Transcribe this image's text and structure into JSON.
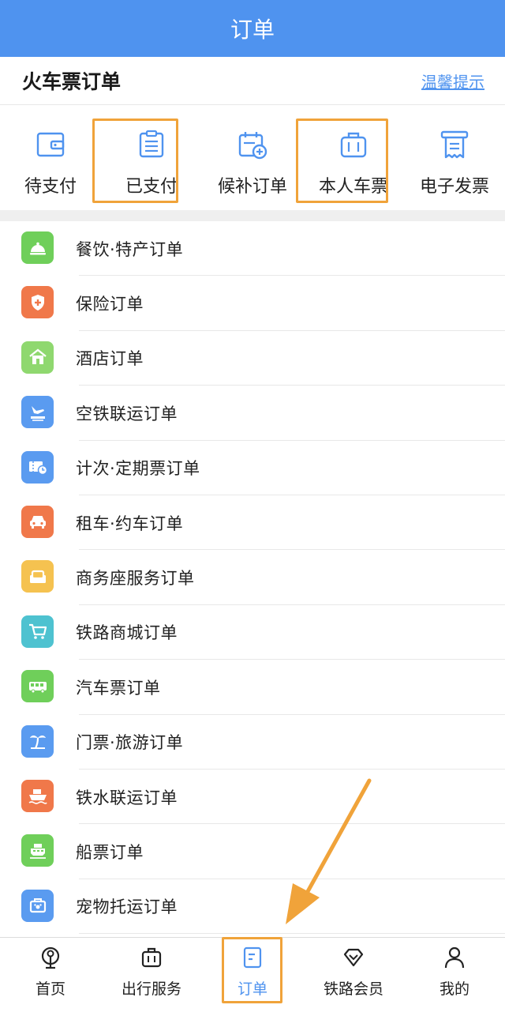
{
  "header": {
    "title": "订单"
  },
  "section": {
    "title": "火车票订单",
    "tips_link": "温馨提示"
  },
  "quick_actions": [
    {
      "label": "待支付",
      "icon": "wallet-icon"
    },
    {
      "label": "已支付",
      "icon": "paid-list-icon"
    },
    {
      "label": "候补订单",
      "icon": "calendar-add-icon"
    },
    {
      "label": "本人车票",
      "icon": "luggage-icon"
    },
    {
      "label": "电子发票",
      "icon": "invoice-icon"
    }
  ],
  "orders": [
    {
      "label": "餐饮·特产订单",
      "icon": "dining-bell-icon",
      "color": "#6fcf5a"
    },
    {
      "label": "保险订单",
      "icon": "shield-plus-icon",
      "color": "#f0784a"
    },
    {
      "label": "酒店订单",
      "icon": "hotel-icon",
      "color": "#8fd86f"
    },
    {
      "label": "空铁联运订单",
      "icon": "plane-train-icon",
      "color": "#5a9bf0"
    },
    {
      "label": "计次·定期票订单",
      "icon": "ticket-clock-icon",
      "color": "#5a9bf0"
    },
    {
      "label": "租车·约车订单",
      "icon": "car-icon",
      "color": "#f0784a"
    },
    {
      "label": "商务座服务订单",
      "icon": "sofa-icon",
      "color": "#f5c250"
    },
    {
      "label": "铁路商城订单",
      "icon": "cart-icon",
      "color": "#4ec2d0"
    },
    {
      "label": "汽车票订单",
      "icon": "bus-icon",
      "color": "#6fcf5a"
    },
    {
      "label": "门票·旅游订单",
      "icon": "palm-tree-icon",
      "color": "#5a9bf0"
    },
    {
      "label": "铁水联运订单",
      "icon": "ship-train-icon",
      "color": "#f0784a"
    },
    {
      "label": "船票订单",
      "icon": "ferry-icon",
      "color": "#6fcf5a"
    },
    {
      "label": "宠物托运订单",
      "icon": "pet-carrier-icon",
      "color": "#5a9bf0"
    }
  ],
  "tabbar": [
    {
      "label": "首页",
      "icon": "railway-home-icon"
    },
    {
      "label": "出行服务",
      "icon": "suitcase-icon"
    },
    {
      "label": "订单",
      "icon": "order-doc-icon",
      "active": true
    },
    {
      "label": "铁路会员",
      "icon": "diamond-icon"
    },
    {
      "label": "我的",
      "icon": "person-icon"
    }
  ],
  "colors": {
    "primary": "#4f93ef",
    "highlight": "#f0a33a"
  }
}
